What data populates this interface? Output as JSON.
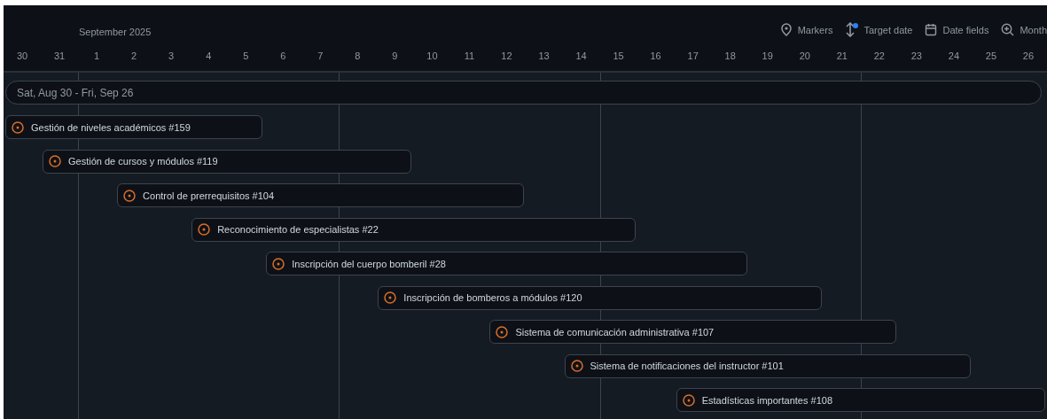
{
  "header": {
    "month": "September 2025",
    "toolbar": [
      {
        "kind": "markers",
        "label": "Markers"
      },
      {
        "kind": "target",
        "label": "Target date",
        "badge": true
      },
      {
        "kind": "fields",
        "label": "Date fields"
      },
      {
        "kind": "zoom",
        "label": "Month"
      }
    ],
    "days": [
      "30",
      "31",
      "1",
      "2",
      "3",
      "4",
      "5",
      "6",
      "7",
      "8",
      "9",
      "10",
      "11",
      "12",
      "13",
      "14",
      "15",
      "16",
      "17",
      "18",
      "19",
      "20",
      "21",
      "22",
      "23",
      "24",
      "25",
      "26"
    ]
  },
  "range": {
    "label": "Sat, Aug 30 - Fri, Sep 26"
  },
  "items": [
    {
      "title": "Gestión de niveles académicos #159"
    },
    {
      "title": "Gestión de cursos y módulos #119"
    },
    {
      "title": "Control de prerrequisitos #104"
    },
    {
      "title": "Reconocimiento de especialistas #22"
    },
    {
      "title": "Inscripción del cuerpo bomberil #28"
    },
    {
      "title": "Inscripción de bomberos a módulos #120"
    },
    {
      "title": "Sistema de comunicación administrativa #107"
    },
    {
      "title": "Sistema de notificaciones del instructor #101"
    },
    {
      "title": "Estadísticas importantes #108"
    }
  ]
}
